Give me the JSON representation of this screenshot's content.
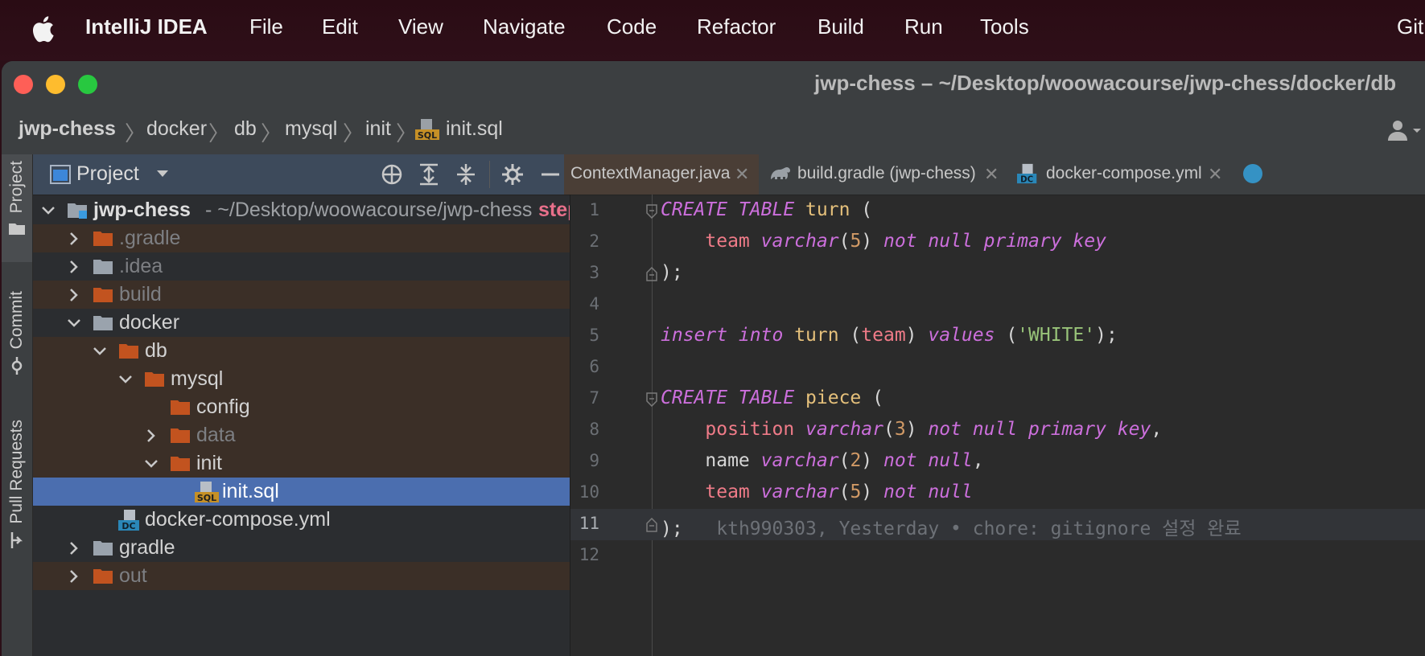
{
  "menubar": {
    "app": "IntelliJ IDEA",
    "items": [
      "File",
      "Edit",
      "View",
      "Navigate",
      "Code",
      "Refactor",
      "Build",
      "Run",
      "Tools",
      "Git"
    ]
  },
  "window": {
    "title": "jwp-chess – ~/Desktop/woowacourse/jwp-chess/docker/db"
  },
  "breadcrumb": [
    "jwp-chess",
    "docker",
    "db",
    "mysql",
    "init",
    "init.sql"
  ],
  "side_tabs": [
    "Project",
    "Commit",
    "Pull Requests"
  ],
  "project_panel": {
    "title": "Project",
    "root_name": "jwp-chess",
    "root_path": "- ~/Desktop/woowacourse/jwp-chess",
    "root_branch": "step",
    "items": [
      {
        "name": ".gradle"
      },
      {
        "name": ".idea"
      },
      {
        "name": "build"
      },
      {
        "name": "docker"
      },
      {
        "name": "db"
      },
      {
        "name": "mysql"
      },
      {
        "name": "config"
      },
      {
        "name": "data"
      },
      {
        "name": "init"
      },
      {
        "name": "init.sql"
      },
      {
        "name": "docker-compose.yml"
      },
      {
        "name": "gradle"
      },
      {
        "name": "out"
      }
    ]
  },
  "editor": {
    "tabs": [
      {
        "label": "ContextManager.java"
      },
      {
        "label": "build.gradle (jwp-chess)"
      },
      {
        "label": "docker-compose.yml"
      }
    ],
    "line_numbers": [
      "1",
      "2",
      "3",
      "4",
      "5",
      "6",
      "7",
      "8",
      "9",
      "10",
      "11",
      "12"
    ],
    "code": {
      "l1": {
        "kw": "CREATE TABLE",
        "tbl": "turn",
        "rest": "("
      },
      "l2": {
        "col": "team",
        "type": "varchar",
        "n": "5",
        "kw": "not null primary key"
      },
      "l3": {
        "text": ");"
      },
      "l5": {
        "kw1": "insert into",
        "tbl": "turn",
        "col": "team",
        "kw2": "values",
        "str": "'WHITE'",
        "end": ");"
      },
      "l7": {
        "kw": "CREATE TABLE",
        "tbl": "piece",
        "rest": "("
      },
      "l8": {
        "col": "position",
        "type": "varchar",
        "n": "3",
        "kw": "not null primary key",
        "end": ","
      },
      "l9": {
        "col": "name",
        "type": "varchar",
        "n": "2",
        "kw": "not null",
        "end": ","
      },
      "l10": {
        "col": "team",
        "type": "varchar",
        "n": "5",
        "kw": "not null"
      },
      "l11": {
        "text": ");"
      }
    },
    "blame": "kth990303, Yesterday • chore: gitignore 설정 완료"
  }
}
